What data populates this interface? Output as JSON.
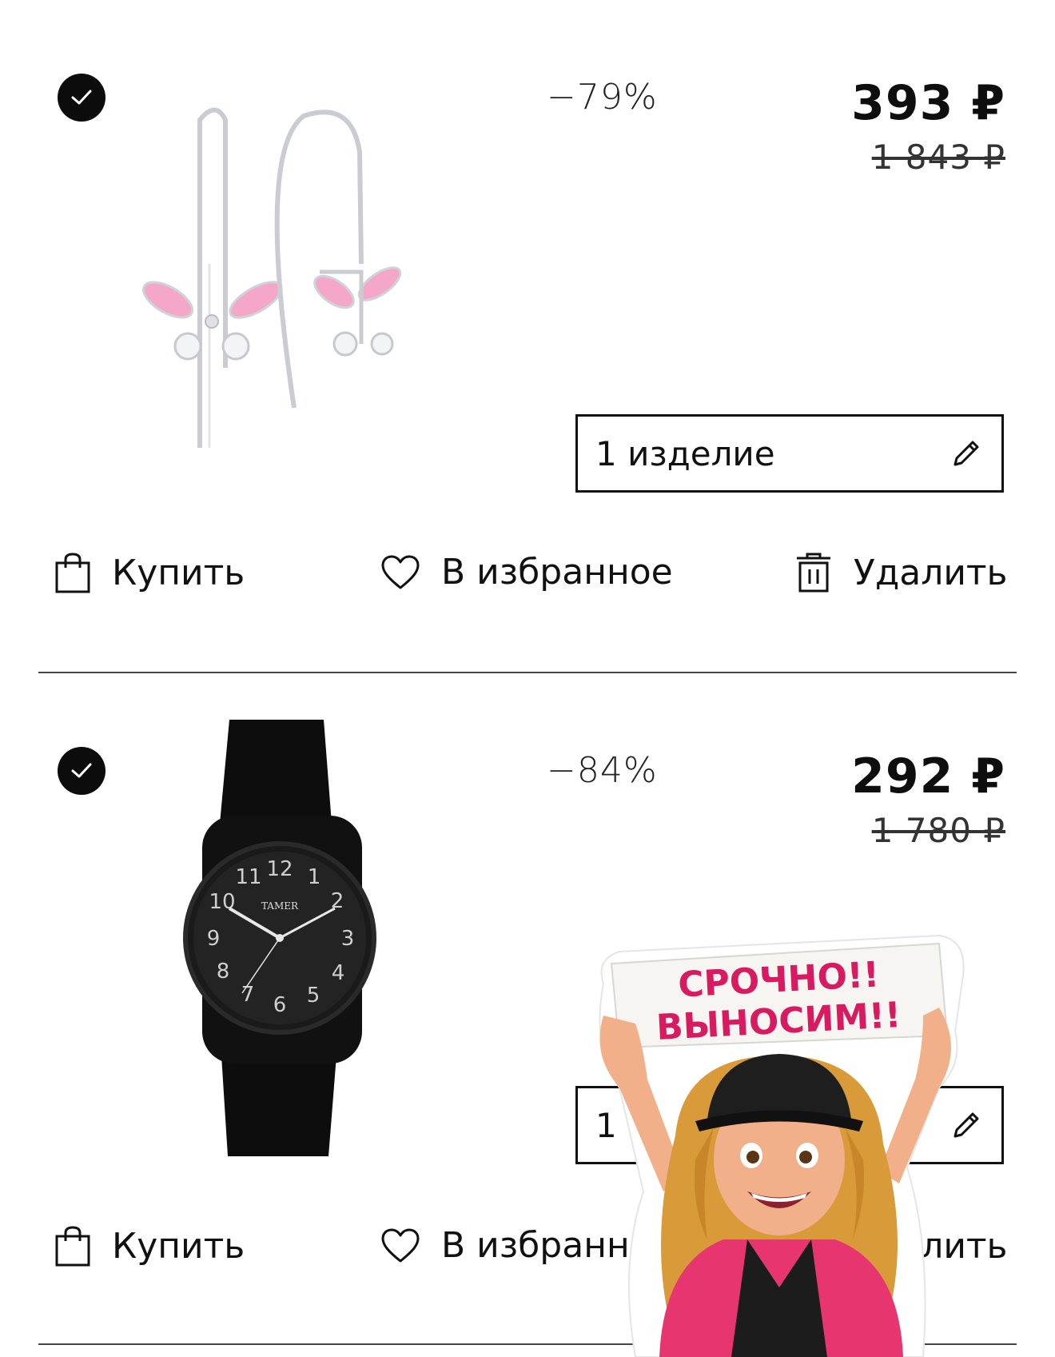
{
  "cart": {
    "items": [
      {
        "name": "Серьги детские бабочки",
        "discount": "−79%",
        "price": "393 ₽",
        "old_price": "1 843 ₽",
        "quantity": "1 изделие",
        "selected": true
      },
      {
        "name": "Часы наручные TAMER",
        "discount": "−84%",
        "price": "292 ₽",
        "old_price": "1 780 ₽",
        "quantity": "1 изделие",
        "watch_brand": "TAMER",
        "selected": true
      }
    ],
    "actions": {
      "buy": "Купить",
      "favorite": "В избранное",
      "delete": "Удалить"
    }
  },
  "sticker": {
    "line1": "СРОЧНО!!",
    "line2": "ВЫНОСИМ!!"
  },
  "colors": {
    "accent_pink": "#d81b60",
    "text": "#111111",
    "divider": "#444444"
  }
}
